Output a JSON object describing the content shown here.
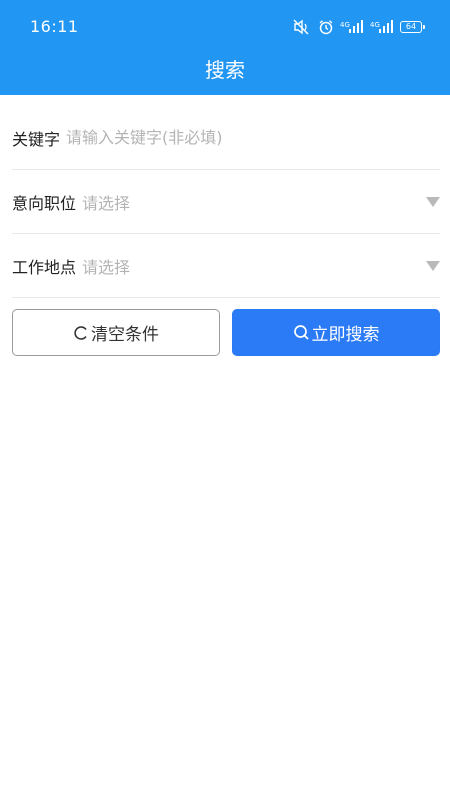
{
  "status_bar": {
    "time": "16:11",
    "battery": "64",
    "icons": [
      "mute-icon",
      "alarm-icon",
      "signal-4g-icon",
      "signal-4g-icon",
      "battery-icon"
    ]
  },
  "header": {
    "title": "搜索",
    "background_color": "#2196f3"
  },
  "form": {
    "keyword": {
      "label": "关键字",
      "placeholder": "请输入关键字(非必填)"
    },
    "position": {
      "label": "意向职位",
      "placeholder": "请选择"
    },
    "location": {
      "label": "工作地点",
      "placeholder": "请选择"
    }
  },
  "actions": {
    "clear_label": "清空条件",
    "search_label": "立即搜索",
    "search_color": "#2c7bf6"
  }
}
